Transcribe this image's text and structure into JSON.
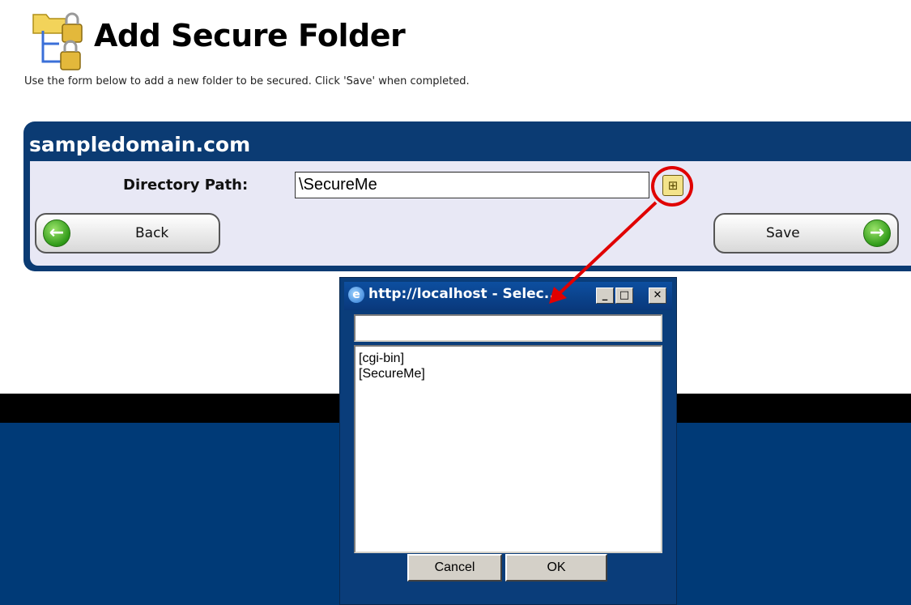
{
  "page": {
    "title": "Add Secure Folder",
    "description": "Use the form below to add a new folder to be secured. Click 'Save' when completed.",
    "icon": "secure-folder-icon"
  },
  "form": {
    "domain": "sampledomain.com",
    "directory_label": "Directory Path:",
    "directory_value": "\\SecureMe",
    "browse_icon": "folder-tree-icon",
    "back_label": "Back",
    "save_label": "Save"
  },
  "annotation": {
    "highlight_color": "#e00000"
  },
  "popup": {
    "title": "http://localhost - Selec...",
    "input_value": "",
    "list_items": [
      "[cgi-bin]",
      "[SecureMe]"
    ],
    "cancel_label": "Cancel",
    "ok_label": "OK"
  },
  "colors": {
    "panel": "#0b3b73",
    "panel_inner": "#e8e8f5",
    "arrow_green": "#2f9a18",
    "page_band": "#003a77"
  }
}
